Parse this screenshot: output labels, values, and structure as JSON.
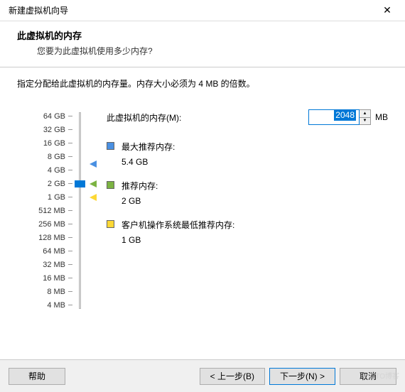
{
  "window": {
    "title": "新建虚拟机向导",
    "close": "✕"
  },
  "header": {
    "title": "此虚拟机的内存",
    "subtitle": "您要为此虚拟机使用多少内存?"
  },
  "instruction": "指定分配给此虚拟机的内存量。内存大小必须为 4 MB 的倍数。",
  "memory": {
    "label": "此虚拟机的内存(M):",
    "value": "2048",
    "unit": "MB"
  },
  "scale": {
    "ticks": [
      "64 GB",
      "32 GB",
      "16 GB",
      "8 GB",
      "4 GB",
      "2 GB",
      "1 GB",
      "512 MB",
      "256 MB",
      "128 MB",
      "64 MB",
      "32 MB",
      "16 MB",
      "8 MB",
      "4 MB"
    ]
  },
  "markers": {
    "max": {
      "label": "最大推荐内存:",
      "value": "5.4 GB"
    },
    "rec": {
      "label": "推荐内存:",
      "value": "2 GB"
    },
    "min": {
      "label": "客户机操作系统最低推荐内存:",
      "value": "1 GB"
    }
  },
  "footer": {
    "help": "帮助",
    "back": "< 上一步(B)",
    "next": "下一步(N) >",
    "cancel": "取消"
  },
  "watermark": "51CTO博客"
}
